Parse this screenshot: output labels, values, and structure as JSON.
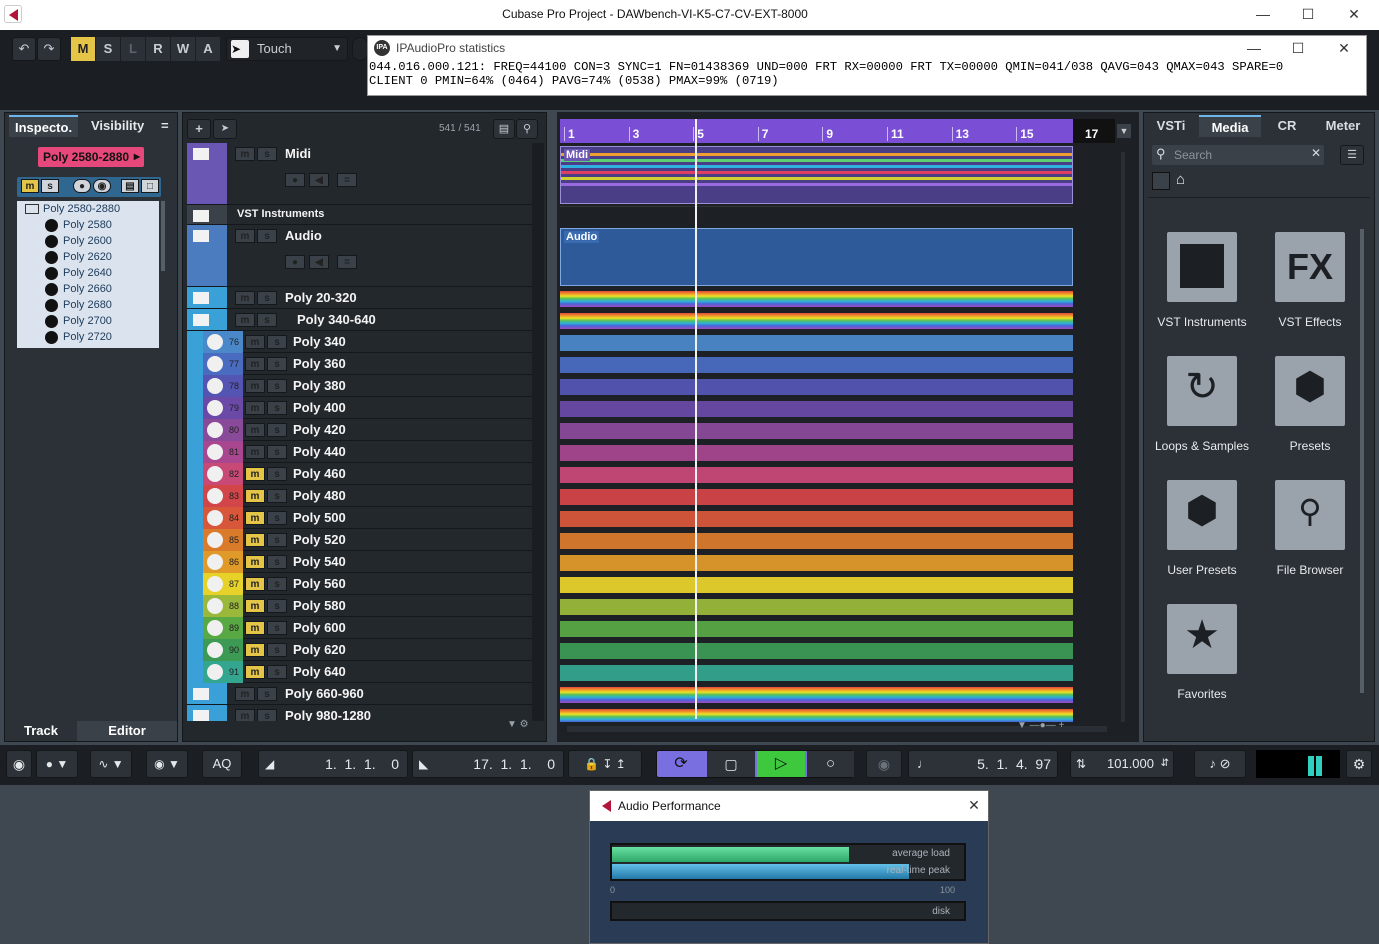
{
  "window": {
    "title": "Cubase Pro Project - DAWbench-VI-K5-C7-CV-EXT-8000"
  },
  "toolbar": {
    "undo": "↶",
    "redo": "↷",
    "modes": [
      "M",
      "S",
      "L",
      "R",
      "W",
      "A"
    ],
    "automation_mode": "Touch"
  },
  "ipa": {
    "title": "IPAudioPro statistics",
    "line1": "044.016.000.121: FREQ=44100 CON=3 SYNC=1 FN=01438369 UND=000 FRT RX=00000 FRT TX=00000 QMIN=041/038 QAVG=043 QMAX=043 SPARE=0",
    "line2": "CLIENT 0 PMIN=64% (0464) PAVG=74% (0538) PMAX=99% (0719)"
  },
  "inspector": {
    "tabs": [
      "Inspecto.",
      "Visibility"
    ],
    "menu": "=",
    "selected_track": "Poly 2580-2880",
    "folder": "Poly 2580-2880",
    "items": [
      "Poly 2580",
      "Poly 2600",
      "Poly 2620",
      "Poly 2640",
      "Poly 2660",
      "Poly 2680",
      "Poly 2700",
      "Poly 2720"
    ],
    "bottom_tabs": [
      "Track",
      "Editor"
    ]
  },
  "tracklist": {
    "count": "541 / 541",
    "folders_top": [
      {
        "name": "Midi"
      },
      {
        "name": "VST Instruments"
      },
      {
        "name": "Audio"
      },
      {
        "name": "Poly 20-320"
      },
      {
        "name": "Poly 340-640"
      }
    ],
    "tracks": [
      {
        "num": "76",
        "name": "Poly 340",
        "color": "#4b88c9"
      },
      {
        "num": "77",
        "name": "Poly 360",
        "color": "#4a6cc0"
      },
      {
        "num": "78",
        "name": "Poly 380",
        "color": "#5455b3"
      },
      {
        "num": "79",
        "name": "Poly 400",
        "color": "#6a4aa6"
      },
      {
        "num": "80",
        "name": "Poly 420",
        "color": "#8a4a9a"
      },
      {
        "num": "81",
        "name": "Poly 440",
        "color": "#a8478f"
      },
      {
        "num": "82",
        "name": "Poly 460",
        "color": "#c84876"
      },
      {
        "num": "83",
        "name": "Poly 480",
        "color": "#d24548"
      },
      {
        "num": "84",
        "name": "Poly 500",
        "color": "#d8573a"
      },
      {
        "num": "85",
        "name": "Poly 520",
        "color": "#da7b2c"
      },
      {
        "num": "86",
        "name": "Poly 540",
        "color": "#e09a2a"
      },
      {
        "num": "87",
        "name": "Poly 560",
        "color": "#e7d22a"
      },
      {
        "num": "88",
        "name": "Poly 580",
        "color": "#9ab83a"
      },
      {
        "num": "89",
        "name": "Poly 600",
        "color": "#58a843"
      },
      {
        "num": "90",
        "name": "Poly 620",
        "color": "#3d9a55"
      },
      {
        "num": "91",
        "name": "Poly 640",
        "color": "#34a58f"
      }
    ],
    "folders_bottom": [
      {
        "name": "Poly 660-960"
      },
      {
        "name": "Poly 980-1280"
      }
    ]
  },
  "arranger": {
    "bars": [
      "1",
      "3",
      "5",
      "7",
      "9",
      "11",
      "13",
      "15",
      "17"
    ],
    "midi_part": "Midi",
    "audio_part": "Audio"
  },
  "mediabay": {
    "tabs": [
      "VSTi",
      "Media",
      "CR",
      "Meter"
    ],
    "search_placeholder": "Search",
    "tiles": [
      "VST Instruments",
      "VST Effects",
      "Loops & Samples",
      "Presets",
      "User Presets",
      "File Browser",
      "Favorites"
    ],
    "tile_icons": [
      "piano-keys-icon",
      "fx-icon",
      "loop-arrow-icon",
      "hexagons-icon",
      "user-hexagon-icon",
      "file-browser-icon",
      "star-icon"
    ]
  },
  "transport": {
    "aq": "AQ",
    "left_locator": "1.  1.  1.    0",
    "right_locator": "17.  1.  1.    0",
    "position": "5.  1.  4.  97",
    "tempo": "101.000"
  },
  "perf": {
    "title": "Audio Performance",
    "avg_label": "average load",
    "peak_label": "real-time peak",
    "scale_min": "0",
    "scale_max": "100",
    "disk_label": "disk",
    "average_load": 0.74,
    "realtime_peak": 0.99
  }
}
